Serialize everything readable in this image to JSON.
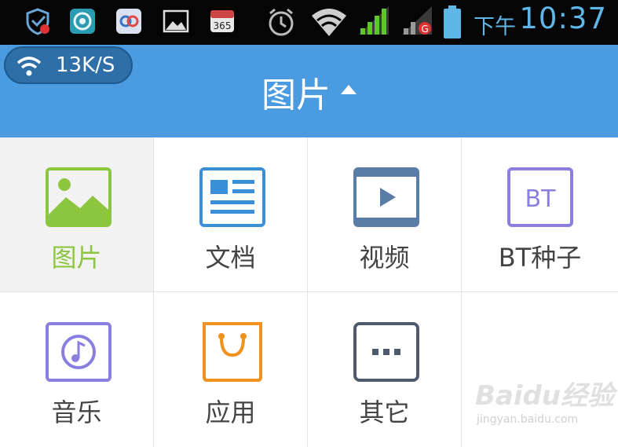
{
  "status_bar": {
    "ampm": "下午",
    "time": "10:37",
    "icons": [
      "shield-icon",
      "camera-app-icon",
      "cloud-sync-icon",
      "gallery-icon",
      "calendar-365-icon",
      "alarm-icon",
      "wifi-icon",
      "signal-icon",
      "signal-roaming-icon",
      "battery-icon"
    ],
    "calendar_text": "365"
  },
  "header": {
    "speed": "13K/S",
    "title": "图片"
  },
  "categories": [
    {
      "label": "图片",
      "icon": "image-icon",
      "color": "#8cc63f",
      "selected": true
    },
    {
      "label": "文档",
      "icon": "document-icon",
      "color": "#3a8fd9",
      "selected": false
    },
    {
      "label": "视频",
      "icon": "video-icon",
      "color": "#5a7da8",
      "selected": false
    },
    {
      "label": "BT种子",
      "icon": "bt-torrent-icon",
      "color": "#8a7fe0",
      "selected": false,
      "icon_text": "BT"
    },
    {
      "label": "音乐",
      "icon": "music-icon",
      "color": "#8a7fe0",
      "selected": false
    },
    {
      "label": "应用",
      "icon": "app-bag-icon",
      "color": "#f0921e",
      "selected": false
    },
    {
      "label": "其它",
      "icon": "more-icon",
      "color": "#4e5a6e",
      "selected": false
    }
  ],
  "watermark": {
    "brand": "Baidu经验",
    "url": "jingyan.baidu.com"
  }
}
